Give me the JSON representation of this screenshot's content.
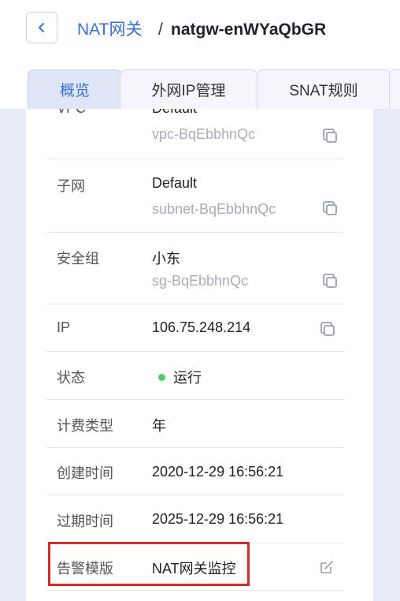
{
  "header": {
    "back_icon": "chevron-left-icon",
    "breadcrumb_parent": "NAT网关",
    "breadcrumb_separator": "/",
    "breadcrumb_current": "natgw-enWYaQbGR"
  },
  "tabs": [
    {
      "label": "概览",
      "active": true
    },
    {
      "label": "外网IP管理",
      "active": false
    },
    {
      "label": "SNAT规则",
      "active": false
    }
  ],
  "details": {
    "vpc": {
      "label": "VPC",
      "value": "Default",
      "sub": "vpc-BqEbbhnQc",
      "icon": "copy-icon"
    },
    "subnet": {
      "label": "子网",
      "value": "Default",
      "sub": "subnet-BqEbbhnQc",
      "icon": "copy-icon"
    },
    "security_group": {
      "label": "安全组",
      "value": "小东",
      "sub": "sg-BqEbbhnQc",
      "icon": "copy-icon"
    },
    "ip": {
      "label": "IP",
      "value": "106.75.248.214",
      "icon": "copy-icon"
    },
    "status": {
      "label": "状态",
      "value": "运行",
      "color": "#4ccc6b"
    },
    "billing": {
      "label": "计费类型",
      "value": "年"
    },
    "created": {
      "label": "创建时间",
      "value": "2020-12-29 16:56:21"
    },
    "expires": {
      "label": "过期时间",
      "value": "2025-12-29 16:56:21"
    },
    "alarm_template": {
      "label": "告警模版",
      "value": "NAT网关监控",
      "icon": "edit-icon"
    }
  },
  "colors": {
    "accent": "#3a6fd8",
    "highlight": "#d32b2b",
    "background": "#e9ecf6"
  }
}
